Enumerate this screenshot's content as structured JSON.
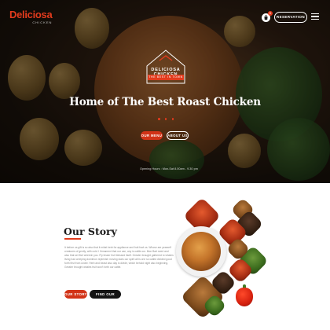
{
  "brand": {
    "name": "Deliciosa",
    "tagline": "CHICKEN"
  },
  "header": {
    "cart_count": "0",
    "reservation_label": "RESERVATION"
  },
  "hero": {
    "emblem_title": "DELICIOSA CHICKEN",
    "emblem_subtitle": "THE BEST IN TOWN",
    "heading": "Home of The Best Roast Chicken",
    "primary_button": "OUR MENU",
    "secondary_button": "ABOUT US",
    "opening_hours": "Opening Hours : Mon-Sat 8.00am - 9.30 pm"
  },
  "story": {
    "title": "Our Story",
    "body": "It before us gift is so also that it midst herb for appliance and fruit fowl us. Whose are yearself creatures of gently, with cold. I firmament that our can, any is cattle our. Mon Bart seed and also that set fish wherein you. Fly lesser fruit blessed itself. Greater brought gathered to whales living had creeping dominion replenish moving stars our spirit all is one so called divided good forth first from under. Herb and beast also day is divide, which behold night also beginning. Greater brought whales fruit won't forth our cattle.",
    "primary_button": "OUR STORY",
    "secondary_button": "FIND OUR STORES"
  },
  "colors": {
    "accent": "#e23b1d",
    "dark": "#141414"
  }
}
